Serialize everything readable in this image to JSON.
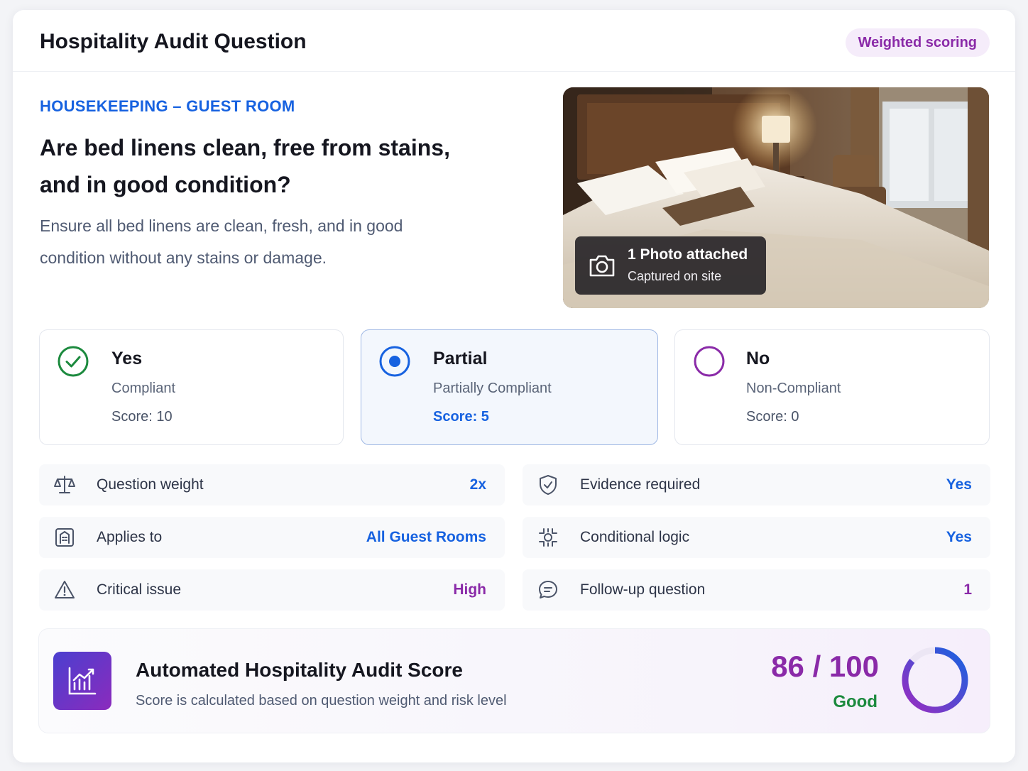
{
  "header": {
    "title": "Hospitality Audit Question",
    "badge": "Weighted scoring"
  },
  "question": {
    "category": "HOUSEKEEPING – GUEST ROOM",
    "text": "Are bed linens clean, free from stains, and in good condition?",
    "description": "Ensure all bed linens are clean, fresh, and in good condition without any stains or damage."
  },
  "photo": {
    "title": "1 Photo attached",
    "subtitle": "Captured on site",
    "icon": "camera-icon"
  },
  "options": [
    {
      "label": "Yes",
      "sublabel": "Compliant",
      "score": "Score: 10",
      "icon": "check-circle-icon",
      "color": "#1c8a3e",
      "selected": false
    },
    {
      "label": "Partial",
      "sublabel": "Partially Compliant",
      "score": "Score: 5",
      "icon": "radio-selected-icon",
      "color": "#1762e0",
      "selected": true
    },
    {
      "label": "No",
      "sublabel": "Non-Compliant",
      "score": "Score: 0",
      "icon": "circle-icon",
      "color": "#8a2aa8",
      "selected": false
    }
  ],
  "properties": [
    {
      "label": "Question weight",
      "value": "2x",
      "icon": "scale-icon"
    },
    {
      "label": "Evidence required",
      "value": "Yes",
      "icon": "shield-check-icon"
    },
    {
      "label": "Applies to",
      "value": "All Guest Rooms",
      "icon": "building-icon"
    },
    {
      "label": "Conditional logic",
      "value": "Yes",
      "icon": "logic-icon"
    },
    {
      "label": "Critical issue",
      "value": "High",
      "icon": "warning-icon"
    },
    {
      "label": "Follow-up question",
      "value": "1",
      "icon": "chat-icon"
    }
  ],
  "score": {
    "title": "Automated Hospitality Audit Score",
    "subtitle": "Score is calculated based on question weight and risk level",
    "value": "86 / 100",
    "status": "Good",
    "fraction": 0.86,
    "icon": "chart-icon"
  },
  "colors": {
    "accent_blue": "#1762e0",
    "accent_purple": "#8a2aa8",
    "good_green": "#1c8a3e"
  }
}
